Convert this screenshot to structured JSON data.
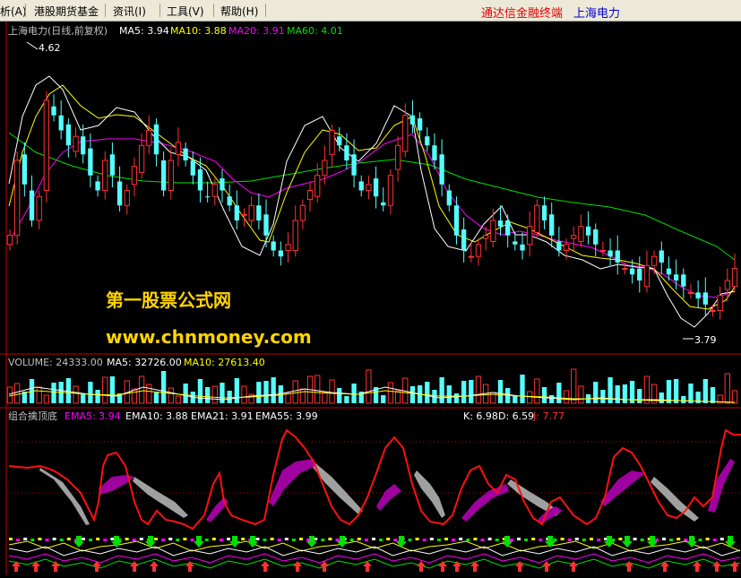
{
  "menu": {
    "items": [
      "析(A)",
      "港股期货基金",
      "资讯(I)",
      "工具(V)",
      "帮助(H)"
    ],
    "brand": "通达信金融终端",
    "stock": "上海电力"
  },
  "main_panel": {
    "title": "上海电力(日线,前复权)",
    "ma5": "MA5: 3.94",
    "ma10": "MA10: 3.88",
    "ma20": "MA20: 3.91",
    "ma60": "MA60: 4.01",
    "high_marker": "4.62",
    "low_marker": "3.79"
  },
  "watermark": {
    "line1": "第一股票公式网",
    "line2": "www.chnmoney.com"
  },
  "volume_panel": {
    "vol": "VOLUME: 24333.00",
    "ma5": "MA5: 32726.00",
    "ma10": "MA10: 27613.40"
  },
  "indicator_panel": {
    "name": "组合擒顶底",
    "ema5": "EMA5: 3.94",
    "ema10": "EMA10: 3.88",
    "ema21": "EMA21: 3.91",
    "ema55": "EMA55: 3.99",
    "k": "K: 6.98",
    "d": "D: 6.59",
    "j": "J: 7.77"
  },
  "colors": {
    "up": "#ff3232",
    "down": "#54ffff",
    "ma5": "#ffffff",
    "ma10": "#ffff00",
    "ma20": "#ff00ff",
    "ma60": "#00e000",
    "separator": "#c80000"
  },
  "chart_data": {
    "type": "candlestick",
    "price_range": [
      3.79,
      4.62
    ],
    "close": [
      4.05,
      4.3,
      4.22,
      4.1,
      4.18,
      4.5,
      4.45,
      4.4,
      4.35,
      4.38,
      4.32,
      4.25,
      4.2,
      4.3,
      4.25,
      4.15,
      4.2,
      4.28,
      4.35,
      4.4,
      4.32,
      4.2,
      4.3,
      4.36,
      4.3,
      4.25,
      4.2,
      4.18,
      4.22,
      4.2,
      4.15,
      4.1,
      4.12,
      4.15,
      4.1,
      4.05,
      4.0,
      3.98,
      4.02,
      4.1,
      4.15,
      4.2,
      4.25,
      4.3,
      4.4,
      4.35,
      4.3,
      4.25,
      4.2,
      4.22,
      4.18,
      4.15,
      4.25,
      4.35,
      4.45,
      4.42,
      4.4,
      4.35,
      4.3,
      4.22,
      4.15,
      4.05,
      4.0,
      3.98,
      4.02,
      4.05,
      4.1,
      4.08,
      4.05,
      4.02,
      4.0,
      4.08,
      4.15,
      4.1,
      4.05,
      4.0,
      4.02,
      4.05,
      4.08,
      4.05,
      4.02,
      4.0,
      3.98,
      3.96,
      3.94,
      3.92,
      3.9,
      3.95,
      3.98,
      3.96,
      3.92,
      3.9,
      3.88,
      3.86,
      3.84,
      3.82,
      3.8,
      3.85,
      3.9,
      3.94
    ]
  }
}
